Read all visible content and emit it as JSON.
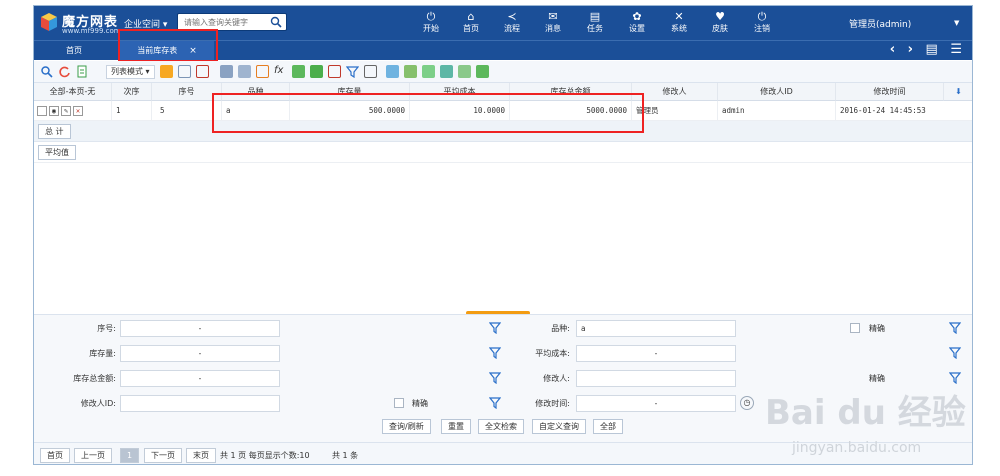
{
  "app": {
    "name": "魔方网表",
    "url": "www.mf999.com",
    "company": "企业空间 ▾",
    "search_placeholder": "请输入查询关键字",
    "user": "管理员(admin)"
  },
  "nav": [
    {
      "label": "开始",
      "icon": "power-icon"
    },
    {
      "label": "首页",
      "icon": "home-icon"
    },
    {
      "label": "流程",
      "icon": "share-icon"
    },
    {
      "label": "消息",
      "icon": "mail-icon"
    },
    {
      "label": "任务",
      "icon": "task-icon"
    },
    {
      "label": "设置",
      "icon": "gear-icon"
    },
    {
      "label": "系统",
      "icon": "tools-icon"
    },
    {
      "label": "皮肤",
      "icon": "skin-icon"
    },
    {
      "label": "注销",
      "icon": "logout-icon"
    }
  ],
  "tabs": {
    "home": "首页",
    "current": "当前库存表",
    "close": "×"
  },
  "tab_controls": "‹ › ▤ ☰",
  "toolbar": {
    "view_mode": "列表模式 ▾"
  },
  "grid": {
    "select_header": "全部-本页-无",
    "columns": [
      "次序",
      "序号",
      "品种",
      "库存量",
      "平均成本",
      "库存总金额",
      "修改人",
      "修改人ID",
      "修改时间"
    ],
    "rows": [
      {
        "order": "1",
        "no": "5",
        "variety": "a",
        "qty": "500.0000",
        "avg_cost": "10.0000",
        "total": "5000.0000",
        "modifier": "管理员",
        "modifier_id": "admin",
        "time": "2016-01-24 14:45:53"
      }
    ],
    "total_label": "总 计",
    "avg_label": "平均值"
  },
  "filter": {
    "no_label": "序号:",
    "no_value": "-",
    "variety_label": "品种:",
    "variety_value": "a",
    "exact1": "精确",
    "qty_label": "库存量:",
    "qty_value": "-",
    "avg_label": "平均成本:",
    "avg_value": "-",
    "total_label": "库存总金额:",
    "total_value": "-",
    "modifier_label": "修改人:",
    "exact2": "精确",
    "modifier_id_label": "修改人ID:",
    "exact3": "精确",
    "time_label": "修改时间:",
    "time_value": "-",
    "buttons": [
      "查询/刷新",
      "重置",
      "全文检索",
      "自定义查询",
      "全部"
    ]
  },
  "pager": {
    "first": "首页",
    "prev": "上一页",
    "page": "1",
    "next": "下一页",
    "last": "末页",
    "info": "共 1 页 每页显示个数:10",
    "count": "共 1 条"
  },
  "watermark": {
    "text": "Bai du 经验",
    "url": "jingyan.baidu.com"
  },
  "colors": {
    "header_bg": "#1b4f98",
    "highlight": "#e22222",
    "accent": "#f39c12"
  }
}
